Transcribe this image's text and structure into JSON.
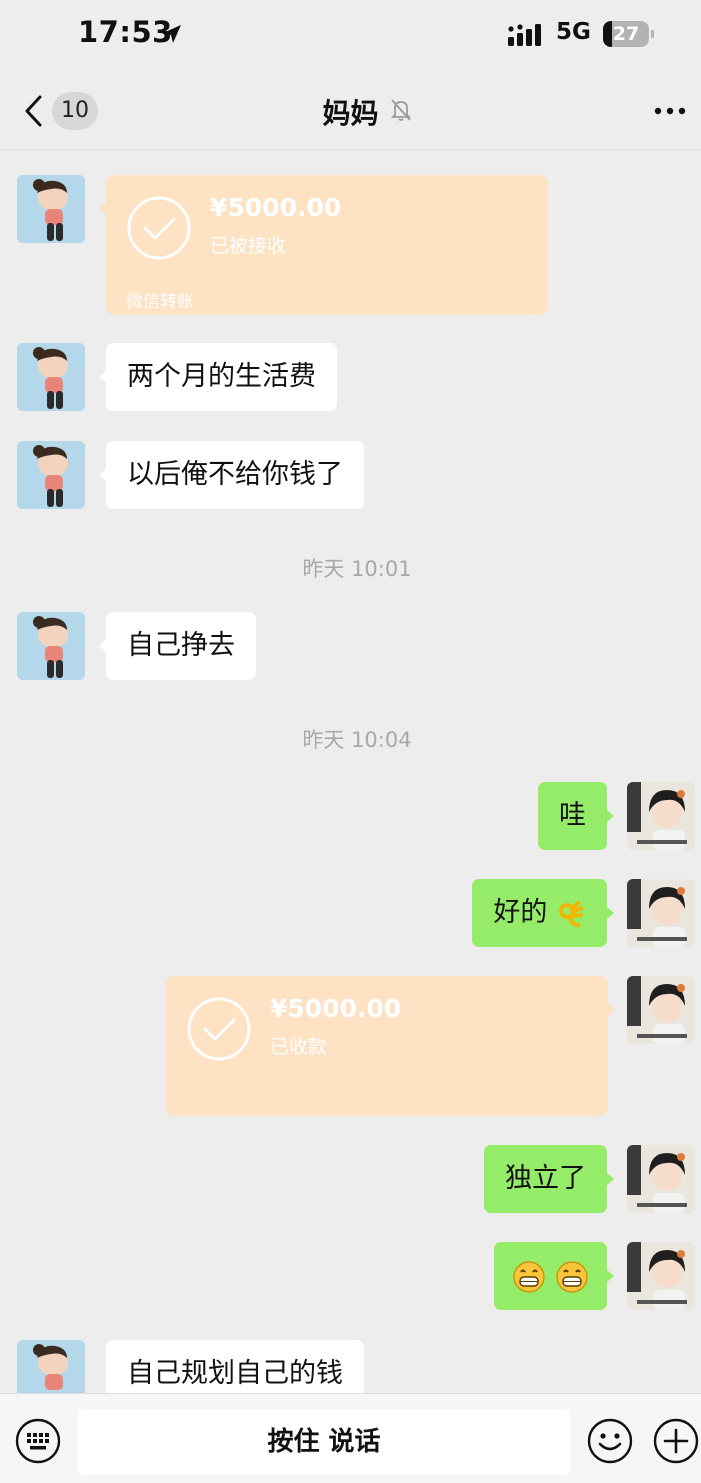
{
  "status_bar": {
    "time": "17:53",
    "network": "5G",
    "battery": "27"
  },
  "header": {
    "unread_count": "10",
    "title": "妈妈",
    "muted": true
  },
  "messages": {
    "transfer_in": {
      "amount": "¥5000.00",
      "status": "已被接收",
      "footer": "微信转账"
    },
    "m1": "两个月的生活费",
    "m2": "以后俺不给你钱了",
    "time1": "昨天 10:01",
    "m3": "自己挣去",
    "time2": "昨天 10:04",
    "m4": "哇",
    "m5": "好的",
    "transfer_out": {
      "amount": "¥5000.00",
      "status": "已收款"
    },
    "m6": "独立了",
    "m8": "自己规划自己的钱"
  },
  "input_bar": {
    "hold_to_talk": "按住 说话"
  },
  "colors": {
    "background": "#ededed",
    "sent_bubble": "#95ec69",
    "received_bubble": "#ffffff",
    "transfer_card": "#fde2c3"
  }
}
